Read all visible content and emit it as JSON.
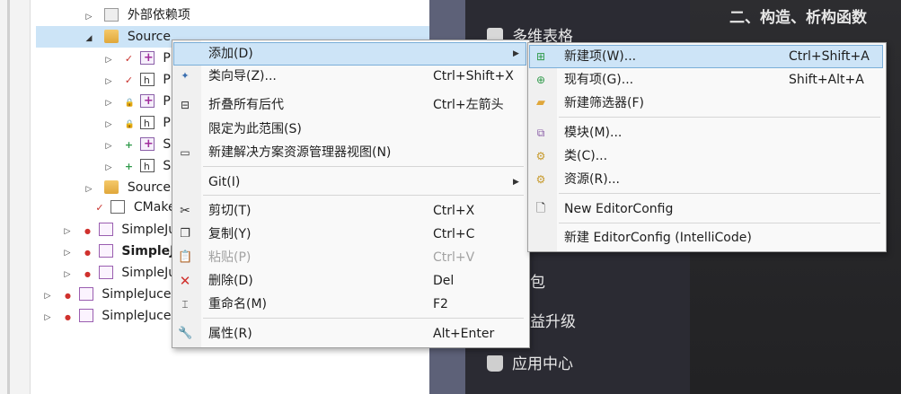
{
  "tree": [
    {
      "label": "外部依赖项",
      "icon": "external-deps-icon",
      "arrow": "▷",
      "marker": ""
    },
    {
      "label": "Source",
      "icon": "filter-icon",
      "arrow": "◢",
      "marker": "",
      "selected": true
    },
    {
      "label": "Plug",
      "icon": "cpp-file-icon",
      "arrow": "▷",
      "marker": "✓"
    },
    {
      "label": "Plug",
      "icon": "header-file-icon",
      "arrow": "▷",
      "marker": "✓"
    },
    {
      "label": "Plug",
      "icon": "cpp-file-icon",
      "arrow": "▷",
      "marker": "🔒"
    },
    {
      "label": "Plug",
      "icon": "header-file-icon",
      "arrow": "▷",
      "marker": "🔒"
    },
    {
      "label": "Squ",
      "icon": "cpp-file-icon",
      "arrow": "▷",
      "marker": "+"
    },
    {
      "label": "Squ",
      "icon": "header-file-icon",
      "arrow": "▷",
      "marker": "+"
    },
    {
      "label": "Source",
      "icon": "filter-icon",
      "arrow": "▷",
      "marker": ""
    },
    {
      "label": "CMake",
      "icon": "text-file-icon",
      "arrow": "",
      "marker": "✓"
    },
    {
      "label": "SimpleJuc",
      "icon": "project-icon",
      "arrow": "▷",
      "marker": "●"
    },
    {
      "label": "SimpleJuc",
      "icon": "project-icon",
      "arrow": "▷",
      "marker": "●",
      "bold": true
    },
    {
      "label": "SimpleJuc",
      "icon": "project-icon",
      "arrow": "▷",
      "marker": "●"
    },
    {
      "label": "SimpleJucePl",
      "icon": "project-icon",
      "arrow": "▷",
      "marker": "●"
    },
    {
      "label": "SimpleJucePl",
      "icon": "project-icon",
      "arrow": "▷",
      "marker": "●"
    }
  ],
  "dark": {
    "top_item": "多维表格",
    "item_package": "包",
    "item_upgrade": "益升级",
    "item_appcenter": "应用中心",
    "title": "二、构造、析构函数"
  },
  "menu1": {
    "items": [
      {
        "label": "添加(D)",
        "shortcut": "",
        "submenu": true,
        "icon": "",
        "hot": true
      },
      {
        "label": "类向导(Z)...",
        "shortcut": "Ctrl+Shift+X",
        "icon": "class-wizard-icon"
      },
      {
        "label": "折叠所有后代",
        "shortcut": "Ctrl+左箭头",
        "icon": "collapse-icon"
      },
      {
        "label": "限定为此范围(S)",
        "shortcut": "",
        "icon": ""
      },
      {
        "label": "新建解决方案资源管理器视图(N)",
        "shortcut": "",
        "icon": "new-view-icon"
      },
      {
        "label": "Git(I)",
        "shortcut": "",
        "submenu": true,
        "icon": ""
      },
      {
        "label": "剪切(T)",
        "shortcut": "Ctrl+X",
        "icon": "cut-icon"
      },
      {
        "label": "复制(Y)",
        "shortcut": "Ctrl+C",
        "icon": "copy-icon"
      },
      {
        "label": "粘贴(P)",
        "shortcut": "Ctrl+V",
        "icon": "paste-icon",
        "disabled": true
      },
      {
        "label": "删除(D)",
        "shortcut": "Del",
        "icon": "delete-icon"
      },
      {
        "label": "重命名(M)",
        "shortcut": "F2",
        "icon": "rename-icon"
      },
      {
        "label": "属性(R)",
        "shortcut": "Alt+Enter",
        "icon": "wrench-icon"
      }
    ]
  },
  "menu2": {
    "items": [
      {
        "label": "新建项(W)...",
        "shortcut": "Ctrl+Shift+A",
        "icon": "new-item-icon",
        "hot": true
      },
      {
        "label": "现有项(G)...",
        "shortcut": "Shift+Alt+A",
        "icon": "existing-item-icon"
      },
      {
        "label": "新建筛选器(F)",
        "shortcut": "",
        "icon": "new-filter-icon"
      },
      {
        "label": "模块(M)...",
        "shortcut": "",
        "icon": "module-icon"
      },
      {
        "label": "类(C)...",
        "shortcut": "",
        "icon": "class-icon"
      },
      {
        "label": "资源(R)...",
        "shortcut": "",
        "icon": "resource-icon"
      },
      {
        "label": "New EditorConfig",
        "shortcut": "",
        "icon": "editorconfig-icon"
      },
      {
        "label": "新建 EditorConfig (IntelliCode)",
        "shortcut": "",
        "icon": ""
      }
    ]
  },
  "colors": {
    "hot": "#cde4f7",
    "menu_bg": "#f9f9f9",
    "dark_bg": "#2b2b33",
    "scroll": "#5d6178"
  }
}
